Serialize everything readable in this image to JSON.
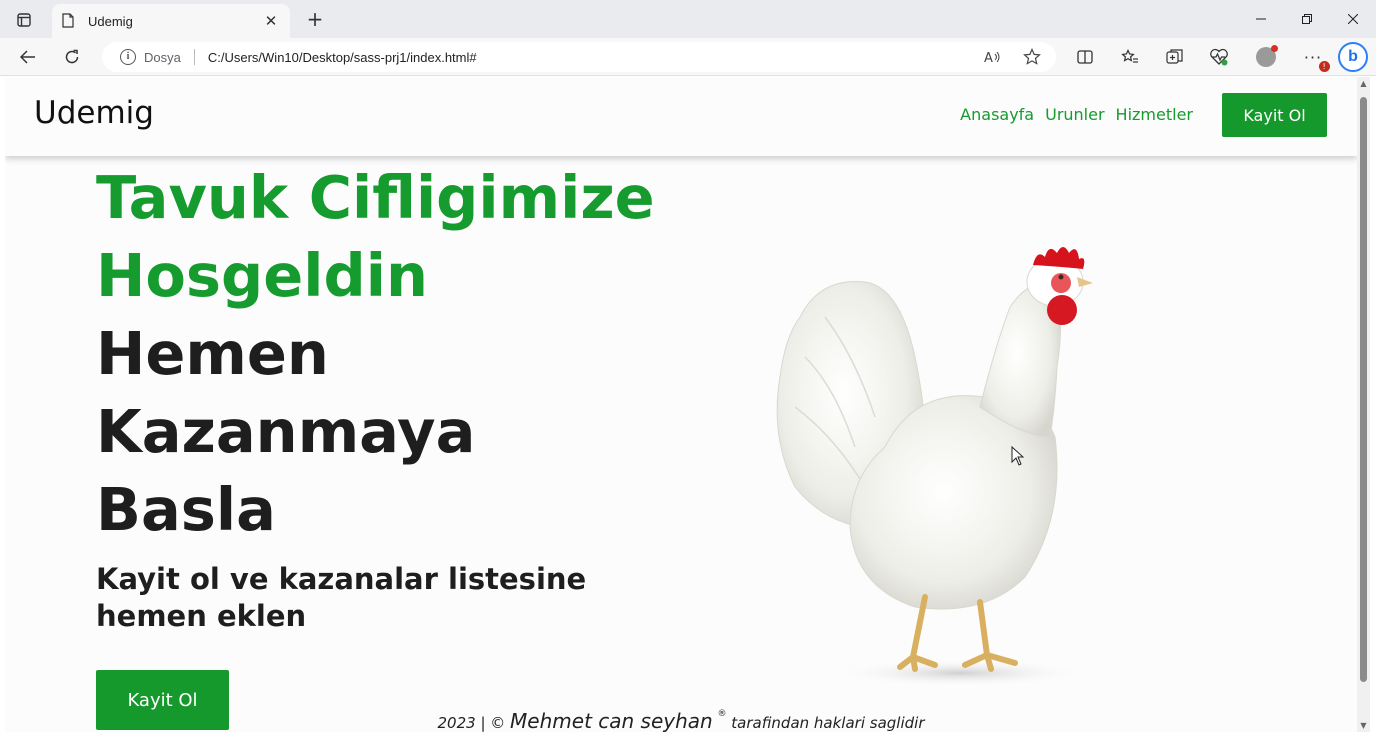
{
  "browser": {
    "tab_title": "Udemig",
    "scheme_label": "Dosya",
    "url": "C:/Users/Win10/Desktop/sass-prj1/index.html#",
    "new_tab_symbol": "+",
    "close_symbol": "✕"
  },
  "site": {
    "logo": "Udemig",
    "nav": [
      "Anasayfa",
      "Urunler",
      "Hizmetler"
    ],
    "header_button": "Kayit Ol",
    "hero": {
      "title_green": [
        "Tavuk Cifligimize",
        "Hosgeldin"
      ],
      "title_dark": [
        "Hemen",
        "Kazanmaya",
        "Basla"
      ],
      "subtitle": "Kayit ol ve kazanalar listesine hemen eklen",
      "button": "Kayit Ol"
    },
    "footer": {
      "prefix": "2023 | ©",
      "author": "Mehmet can seyhan",
      "registered": "®",
      "suffix": "tarafindan haklari saglidir"
    }
  },
  "colors": {
    "brand_green": "#169b2e",
    "button_green": "#15982c",
    "text_dark": "#1e1e1e"
  },
  "icons": [
    "tab-actions-icon",
    "page-icon",
    "back-icon",
    "reload-icon",
    "info-icon",
    "read-aloud-icon",
    "favorite-star-icon",
    "split-screen-icon",
    "favorites-icon",
    "collections-icon",
    "health-icon",
    "profile-icon",
    "more-icon",
    "bing-icon"
  ]
}
